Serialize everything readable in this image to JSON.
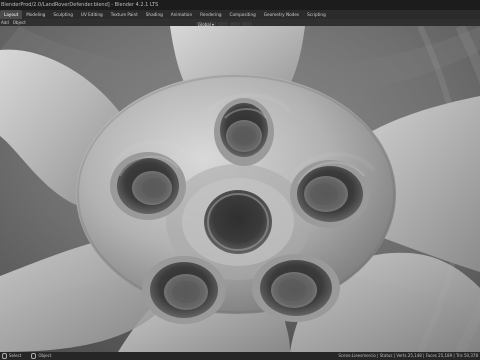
{
  "window": {
    "title": "BlenderProd/2.0/LandRoverDefender.blend] - Blender 4.2.1 LTS"
  },
  "workspace_tabs": [
    {
      "label": "Layout",
      "active": true
    },
    {
      "label": "Modeling",
      "active": false
    },
    {
      "label": "Sculpting",
      "active": false
    },
    {
      "label": "UV Editing",
      "active": false
    },
    {
      "label": "Texture Paint",
      "active": false
    },
    {
      "label": "Shading",
      "active": false
    },
    {
      "label": "Animation",
      "active": false
    },
    {
      "label": "Rendering",
      "active": false
    },
    {
      "label": "Compositing",
      "active": false
    },
    {
      "label": "Geometry Nodes",
      "active": false
    },
    {
      "label": "Scripting",
      "active": false
    }
  ],
  "scene": {
    "label": "Scene"
  },
  "viewport_header": {
    "menu": [
      "Add",
      "Object"
    ],
    "toolbar": {
      "transform_orientation": "Global"
    }
  },
  "status_bar": {
    "left": [
      {
        "label": "Select"
      },
      {
        "label": "Object"
      }
    ],
    "right": "Scene.Lieesmercio | Status | Verts 25,148 | Faces 25,189 | Tris 50,378"
  },
  "colors": {
    "viewport_bg": "#6b6b6b",
    "wheel_surface": "#b5b5b5",
    "wheel_shadow": "#7a7a7a",
    "wheel_highlight": "#d9d9d9",
    "ui_dark": "#1d1d1d"
  }
}
